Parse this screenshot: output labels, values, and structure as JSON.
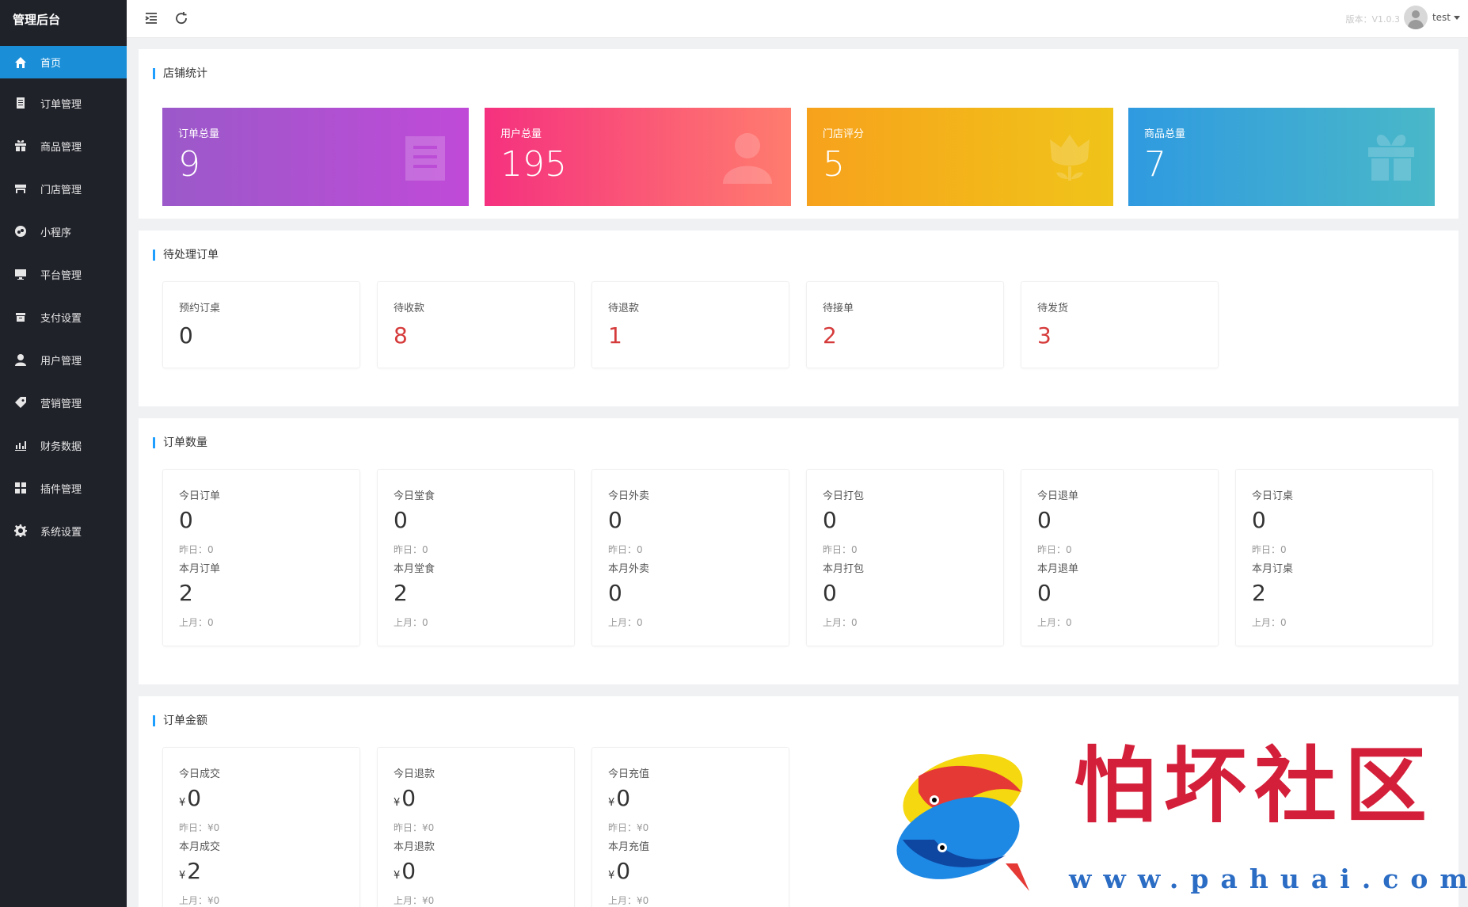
{
  "sidebar": {
    "brand": "管理后台",
    "items": [
      {
        "label": "首页",
        "icon": "home-icon",
        "active": true
      },
      {
        "label": "订单管理",
        "icon": "order-icon"
      },
      {
        "label": "商品管理",
        "icon": "goods-icon"
      },
      {
        "label": "门店管理",
        "icon": "store-icon"
      },
      {
        "label": "小程序",
        "icon": "miniprogram-icon"
      },
      {
        "label": "平台管理",
        "icon": "monitor-icon"
      },
      {
        "label": "支付设置",
        "icon": "payment-icon"
      },
      {
        "label": "用户管理",
        "icon": "user-icon"
      },
      {
        "label": "营销管理",
        "icon": "tag-icon"
      },
      {
        "label": "财务数据",
        "icon": "chart-icon"
      },
      {
        "label": "插件管理",
        "icon": "plugin-icon"
      },
      {
        "label": "系统设置",
        "icon": "gear-icon"
      }
    ]
  },
  "header": {
    "version": "版本：V1.0.3",
    "username": "test"
  },
  "store_stats": {
    "title": "店铺统计",
    "cards": [
      {
        "label": "订单总量",
        "value": "9",
        "icon": "clipboard-icon",
        "color_from": "#9b59c9",
        "color_to": "#c04ad8"
      },
      {
        "label": "用户总量",
        "value": "195",
        "icon": "person-icon",
        "color_from": "#f5317f",
        "color_to": "#ff7c6e"
      },
      {
        "label": "门店评分",
        "value": "5",
        "icon": "flower-icon",
        "color_from": "#f7a21c",
        "color_to": "#f0c419"
      },
      {
        "label": "商品总量",
        "value": "7",
        "icon": "gift-icon",
        "color_from": "#2f9ae0",
        "color_to": "#4ab8c8"
      }
    ]
  },
  "pending_orders": {
    "title": "待处理订单",
    "items": [
      {
        "label": "预约订桌",
        "value": "0",
        "highlight": false
      },
      {
        "label": "待收款",
        "value": "8",
        "highlight": true
      },
      {
        "label": "待退款",
        "value": "1",
        "highlight": true
      },
      {
        "label": "待接单",
        "value": "2",
        "highlight": true
      },
      {
        "label": "待发货",
        "value": "3",
        "highlight": true
      }
    ]
  },
  "order_count": {
    "title": "订单数量",
    "items": [
      {
        "today_label": "今日订单",
        "today": "0",
        "yesterday": "昨日：0",
        "month_label": "本月订单",
        "month": "2",
        "last_month": "上月：0"
      },
      {
        "today_label": "今日堂食",
        "today": "0",
        "yesterday": "昨日：0",
        "month_label": "本月堂食",
        "month": "2",
        "last_month": "上月：0"
      },
      {
        "today_label": "今日外卖",
        "today": "0",
        "yesterday": "昨日：0",
        "month_label": "本月外卖",
        "month": "0",
        "last_month": "上月：0"
      },
      {
        "today_label": "今日打包",
        "today": "0",
        "yesterday": "昨日：0",
        "month_label": "本月打包",
        "month": "0",
        "last_month": "上月：0"
      },
      {
        "today_label": "今日退单",
        "today": "0",
        "yesterday": "昨日：0",
        "month_label": "本月退单",
        "month": "0",
        "last_month": "上月：0"
      },
      {
        "today_label": "今日订桌",
        "today": "0",
        "yesterday": "昨日：0",
        "month_label": "本月订桌",
        "month": "2",
        "last_month": "上月：0"
      }
    ]
  },
  "order_amount": {
    "title": "订单金额",
    "currency": "¥",
    "items": [
      {
        "today_label": "今日成交",
        "today": "0",
        "yesterday": "昨日：¥0",
        "month_label": "本月成交",
        "month": "2",
        "last_month": "上月：¥0"
      },
      {
        "today_label": "今日退款",
        "today": "0",
        "yesterday": "昨日：¥0",
        "month_label": "本月退款",
        "month": "0",
        "last_month": "上月：¥0"
      },
      {
        "today_label": "今日充值",
        "today": "0",
        "yesterday": "昨日：¥0",
        "month_label": "本月充值",
        "month": "0",
        "last_month": "上月：¥0"
      }
    ]
  },
  "watermark": {
    "text": "怕坏社区",
    "url": "www.pahuai.com"
  }
}
